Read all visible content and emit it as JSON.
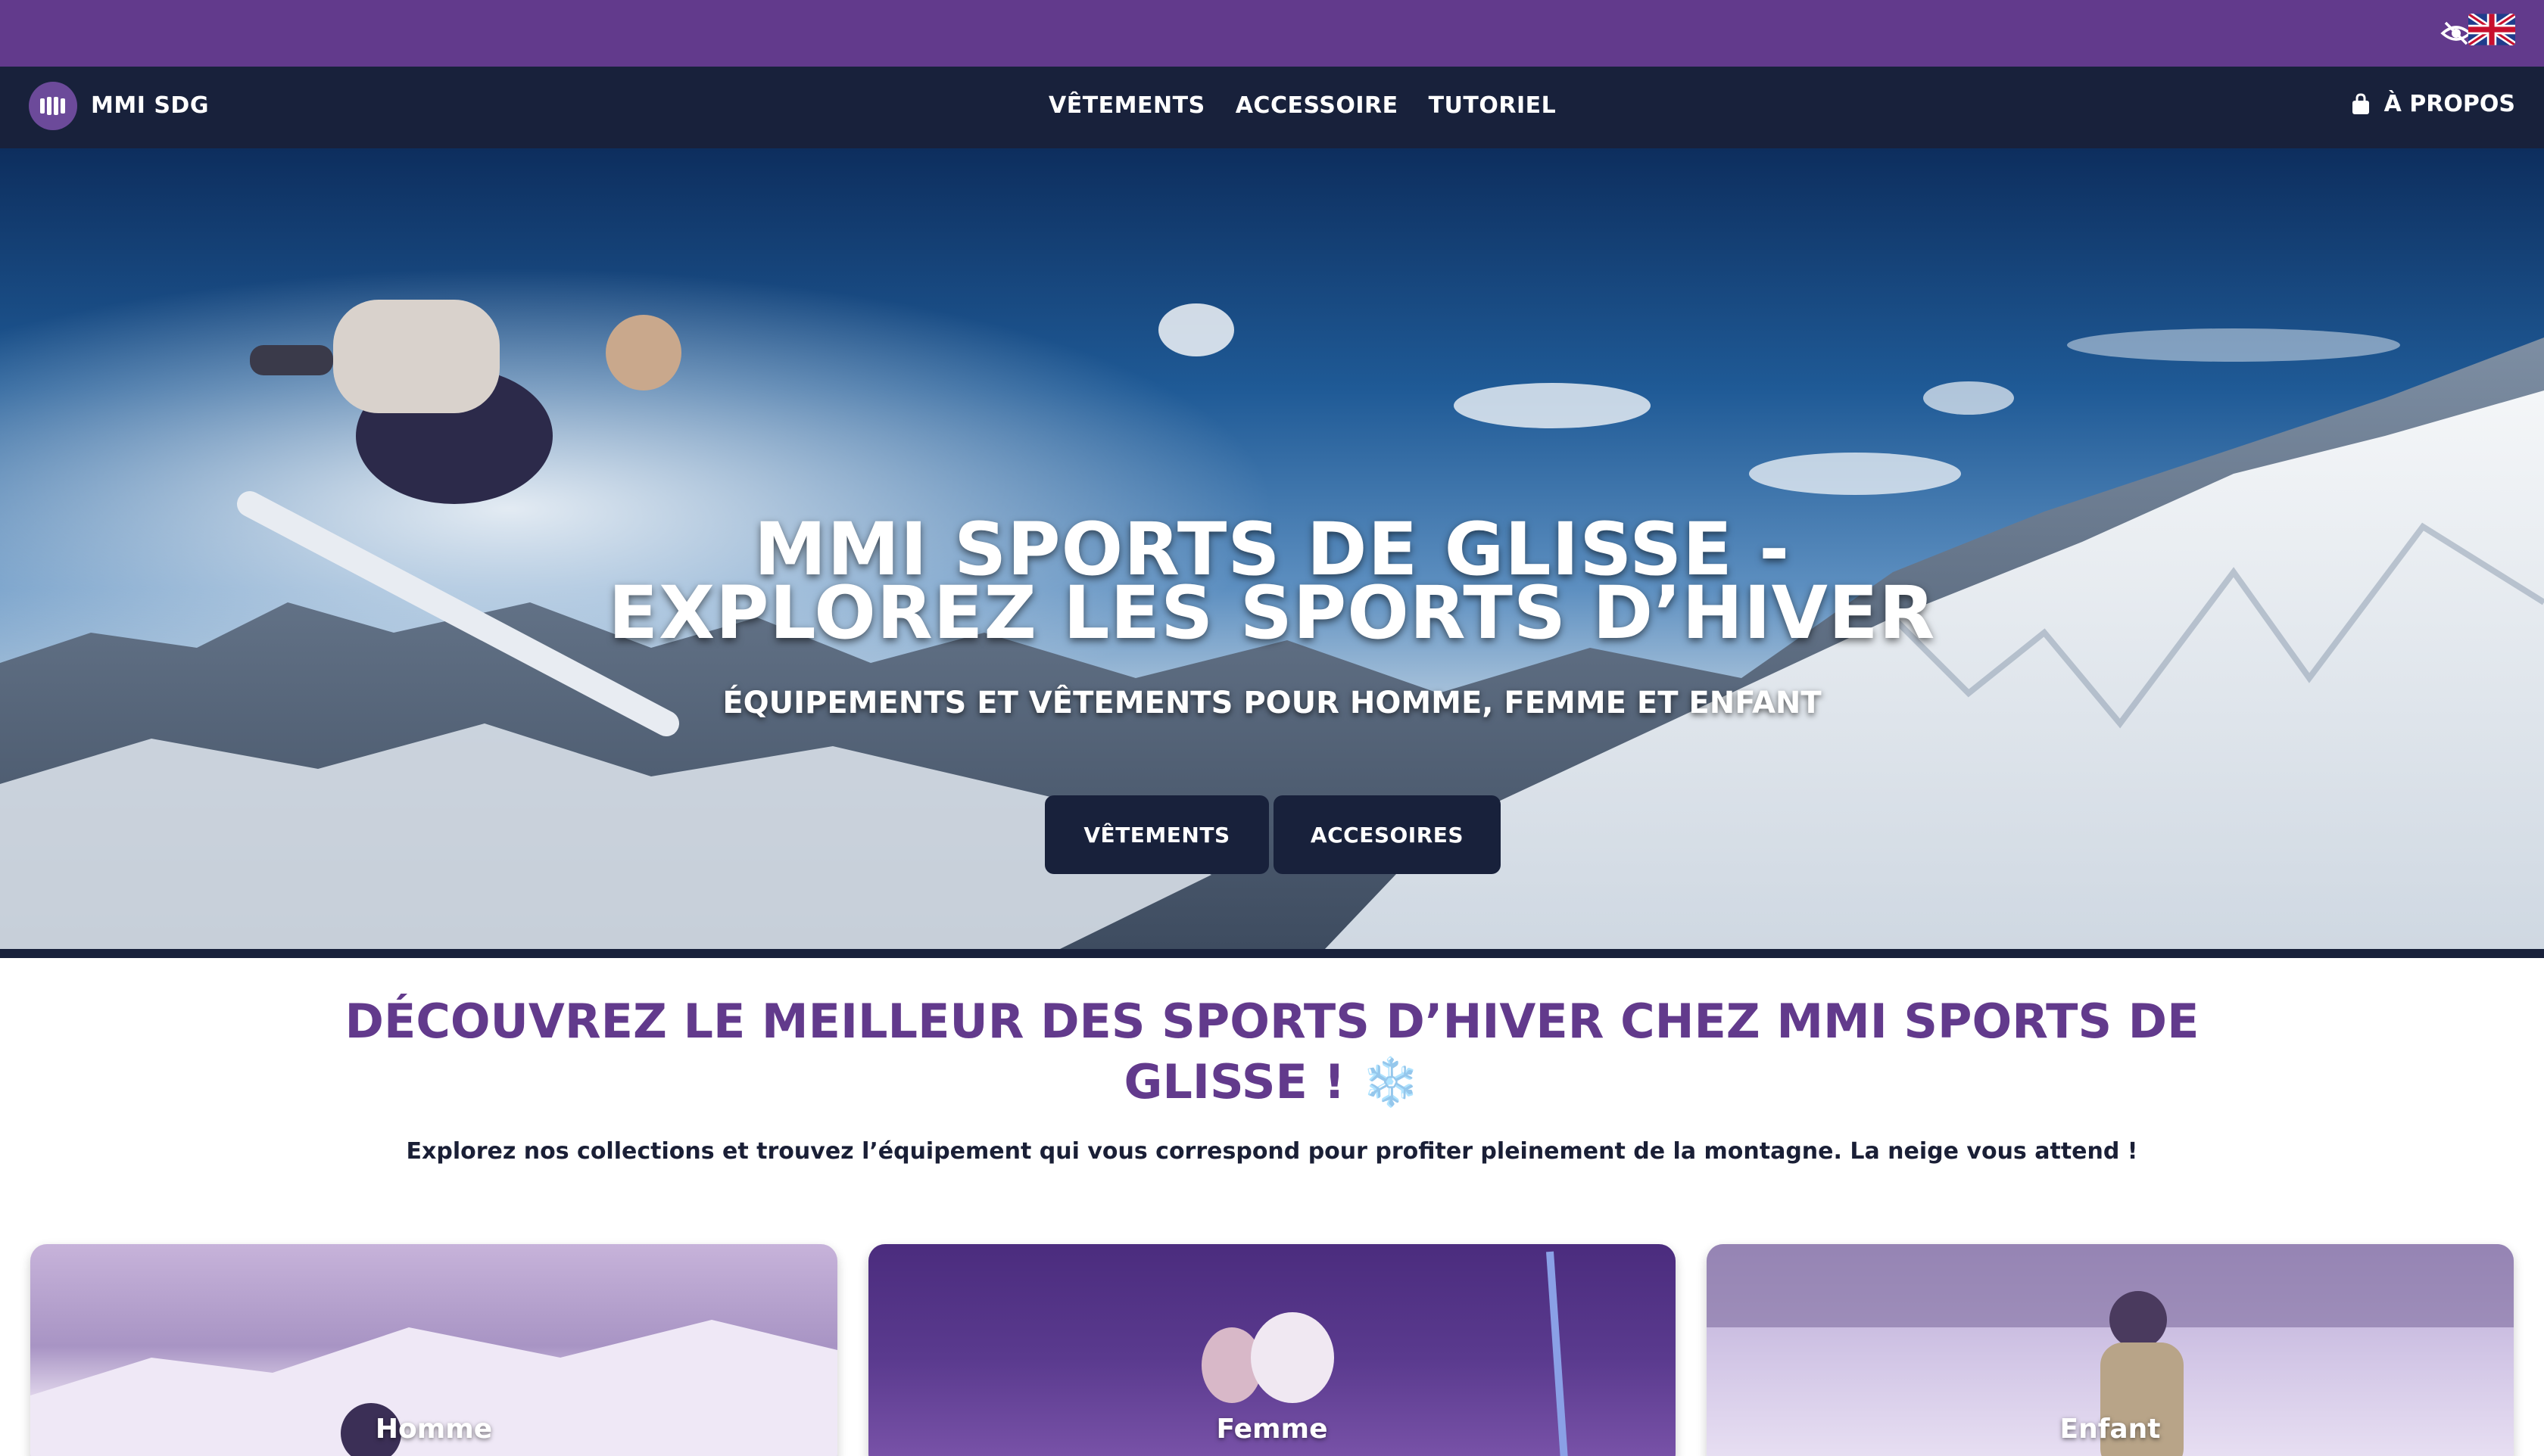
{
  "topbar": {
    "accessibility_icon": "eye-slash-icon",
    "language_icon": "uk-flag-icon"
  },
  "nav": {
    "brand": "MMI SDG",
    "links": [
      "VÊTEMENTS",
      "ACCESSOIRE",
      "TUTORIEL"
    ],
    "about": "À PROPOS",
    "about_icon": "shopping-bag-icon"
  },
  "hero": {
    "title_line1": "MMI SPORTS DE GLISSE -",
    "title_line2": "EXPLOREZ LES SPORTS D’HIVER",
    "subtitle": "ÉQUIPEMENTS ET VÊTEMENTS POUR HOMME, FEMME ET ENFANT",
    "button_clothes": "VÊTEMENTS",
    "button_accessories": "ACCESOIRES"
  },
  "intro": {
    "title_line1": "DÉCOUVREZ LE MEILLEUR DES SPORTS D’HIVER CHEZ MMI SPORTS DE",
    "title_line2": "GLISSE !",
    "title_emoji": "❄️",
    "text": "Explorez nos collections et trouvez l’équipement qui vous correspond pour profiter pleinement de la montagne. La neige vous attend !"
  },
  "cards": [
    {
      "label": "Homme"
    },
    {
      "label": "Femme"
    },
    {
      "label": "Enfant"
    }
  ],
  "colors": {
    "purple": "#623a8c",
    "navy": "#18213b"
  }
}
